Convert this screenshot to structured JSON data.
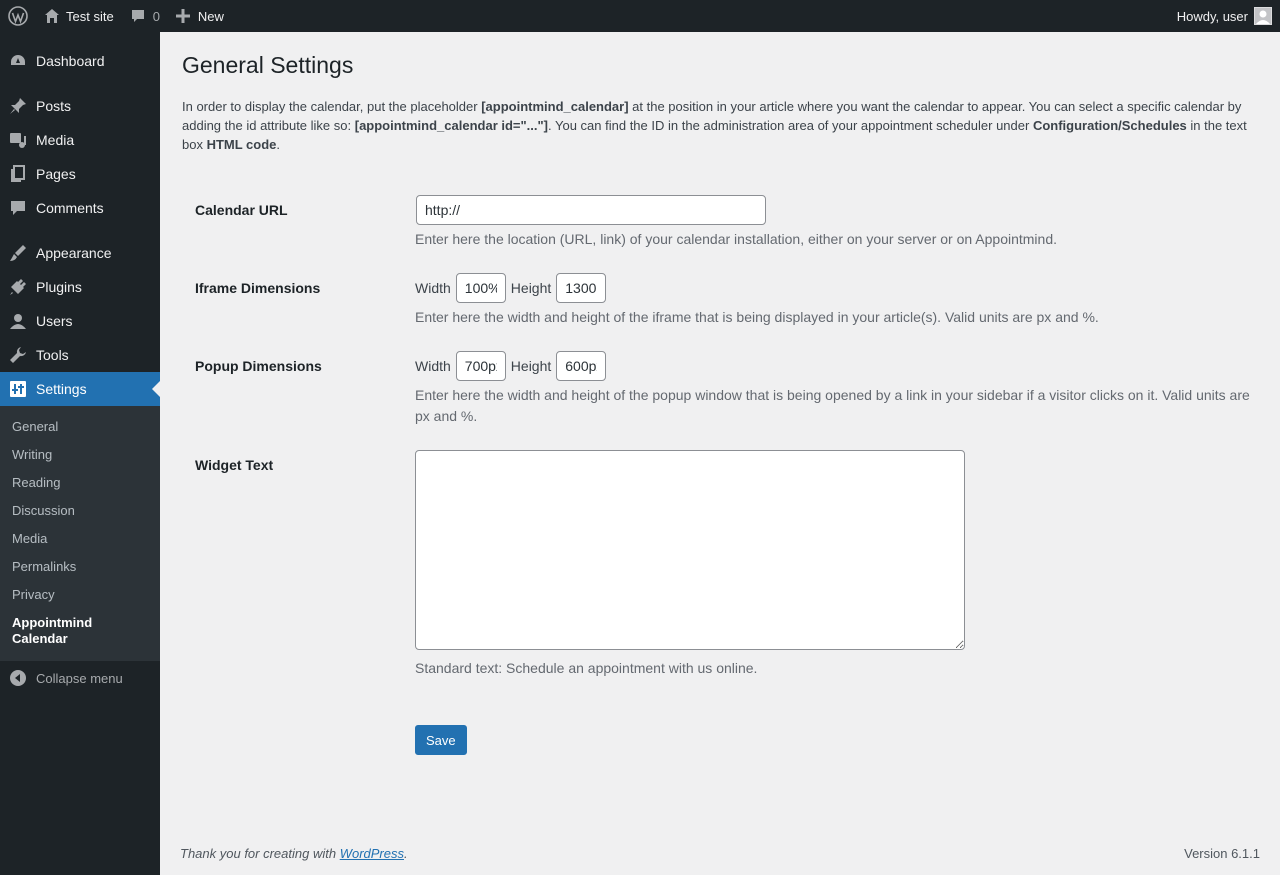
{
  "adminbar": {
    "site_name": "Test site",
    "comments_count": "0",
    "new_label": "New",
    "howdy": "Howdy, user"
  },
  "sidebar": {
    "items": [
      {
        "label": "Dashboard",
        "icon": "dashboard-icon"
      },
      {
        "label": "Posts",
        "icon": "pin-icon"
      },
      {
        "label": "Media",
        "icon": "media-icon"
      },
      {
        "label": "Pages",
        "icon": "pages-icon"
      },
      {
        "label": "Comments",
        "icon": "comment-icon"
      },
      {
        "label": "Appearance",
        "icon": "brush-icon"
      },
      {
        "label": "Plugins",
        "icon": "plug-icon"
      },
      {
        "label": "Users",
        "icon": "user-icon"
      },
      {
        "label": "Tools",
        "icon": "wrench-icon"
      },
      {
        "label": "Settings",
        "icon": "settings-icon"
      }
    ],
    "submenu": [
      "General",
      "Writing",
      "Reading",
      "Discussion",
      "Media",
      "Permalinks",
      "Privacy",
      "Appointmind Calendar"
    ],
    "collapse_label": "Collapse menu"
  },
  "page": {
    "title": "General Settings",
    "intro": {
      "p1": "In order to display the calendar, put the placeholder ",
      "b1": "[appointmind_calendar]",
      "p2": " at the position in your article where you want the calendar to appear. You can select a specific calendar by adding the id attribute like so: ",
      "b2": "[appointmind_calendar id=\"...\"]",
      "p3": ". You can find the ID in the administration area of your appointment scheduler under ",
      "b3": "Configuration/Schedules",
      "p4": " in the text box ",
      "b4": "HTML code",
      "p5": "."
    }
  },
  "form": {
    "calendar_url": {
      "label": "Calendar URL",
      "value": "http://",
      "description": "Enter here the location (URL, link) of your calendar installation, either on your server or on Appointmind."
    },
    "iframe": {
      "label": "Iframe Dimensions",
      "width_label": "Width",
      "width_value": "100%",
      "height_label": "Height",
      "height_value": "1300",
      "description": "Enter here the width and height of the iframe that is being displayed in your article(s). Valid units are px and %."
    },
    "popup": {
      "label": "Popup Dimensions",
      "width_label": "Width",
      "width_value": "700px",
      "height_label": "Height",
      "height_value": "600px",
      "description": "Enter here the width and height of the popup window that is being opened by a link in your sidebar if a visitor clicks on it. Valid units are px and %."
    },
    "widget": {
      "label": "Widget Text",
      "value": "",
      "description": "Standard text: Schedule an appointment with us online."
    },
    "save_label": "Save"
  },
  "footer": {
    "thanks_prefix": "Thank you for creating with ",
    "link": "WordPress",
    "thanks_suffix": ".",
    "version": "Version 6.1.1"
  }
}
